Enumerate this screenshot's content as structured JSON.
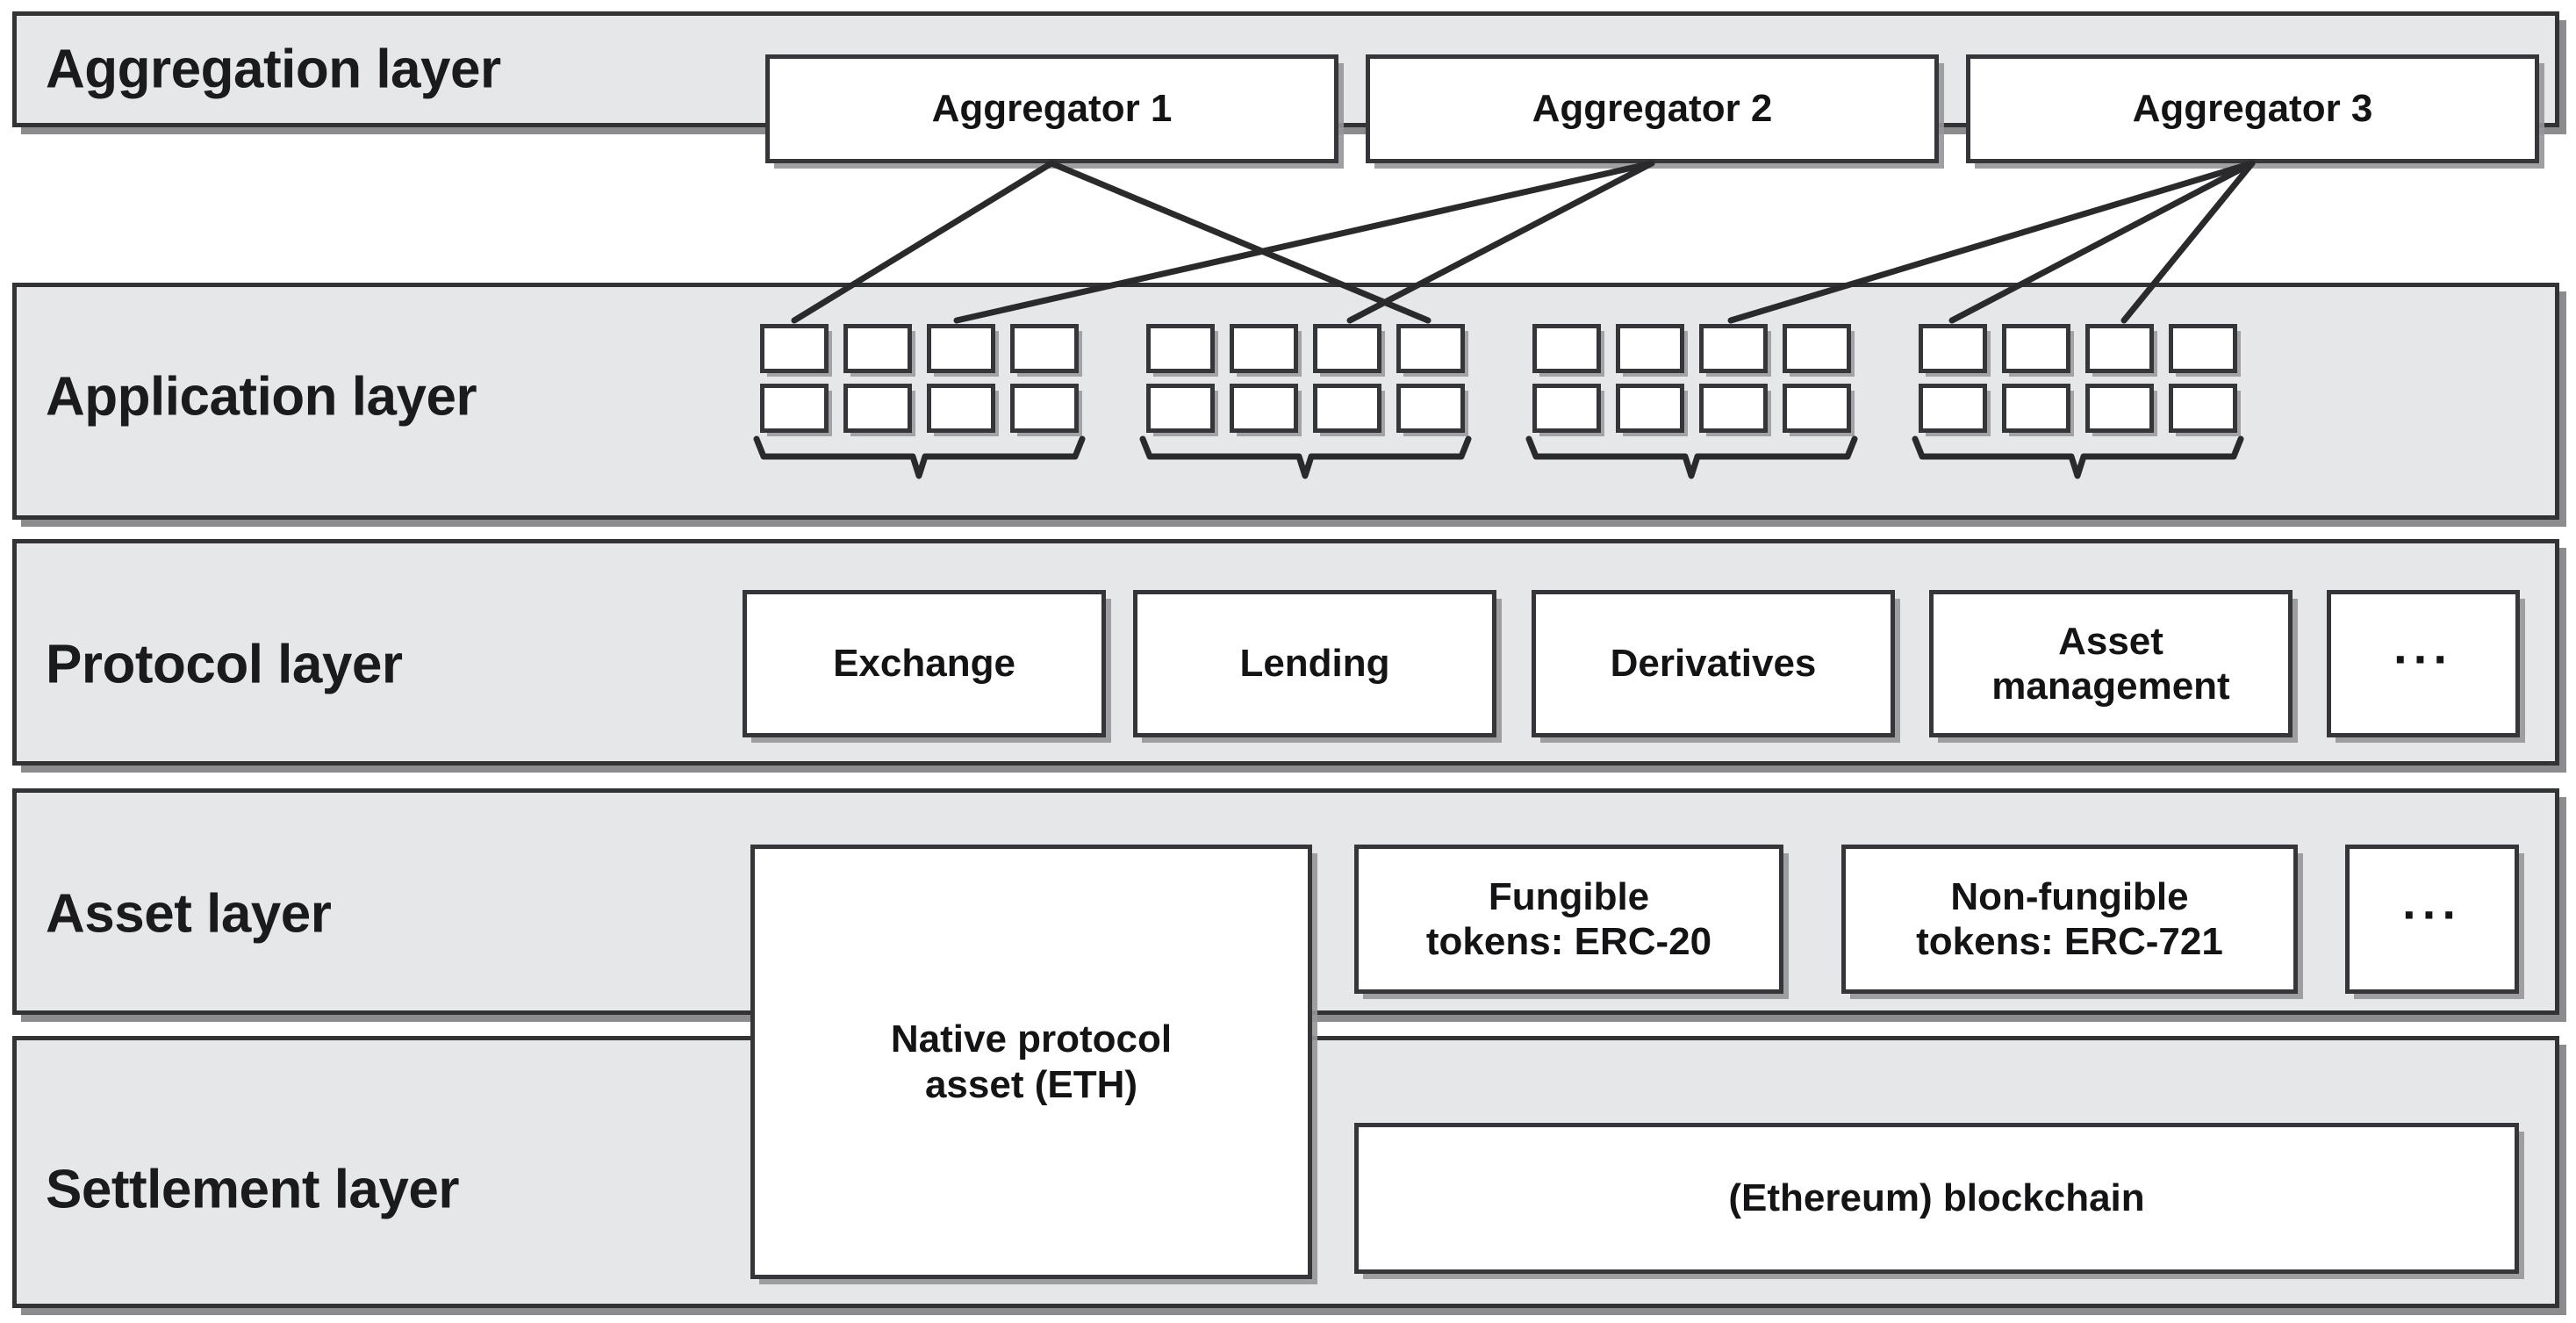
{
  "diagram": {
    "title": "DeFi layered architecture stack",
    "colors": {
      "band_fill": "#e6e7e8",
      "band_border": "#333335",
      "node_fill": "#ffffff",
      "node_border": "#35353a",
      "text": "#141416",
      "shadow": "#96969a"
    }
  },
  "layers": [
    {
      "id": "aggregation",
      "label": "Aggregation layer",
      "nodes": [
        {
          "label": "Aggregator 1"
        },
        {
          "label": "Aggregator 2"
        },
        {
          "label": "Aggregator 3"
        }
      ]
    },
    {
      "id": "application",
      "label": "Application layer",
      "groups": [
        {
          "id": "group-1",
          "columns": 4,
          "rows": 2,
          "count": 8
        },
        {
          "id": "group-2",
          "columns": 4,
          "rows": 2,
          "count": 8
        },
        {
          "id": "group-3",
          "columns": 4,
          "rows": 2,
          "count": 8
        },
        {
          "id": "group-4",
          "columns": 4,
          "rows": 2,
          "count": 8
        }
      ]
    },
    {
      "id": "protocol",
      "label": "Protocol layer",
      "nodes": [
        {
          "label": "Exchange"
        },
        {
          "label": "Lending"
        },
        {
          "label": "Derivatives"
        },
        {
          "label": "Asset\nmanagement"
        },
        {
          "label": "..."
        }
      ]
    },
    {
      "id": "asset",
      "label": "Asset layer",
      "nodes": [
        {
          "label": "Native protocol\nasset (ETH)"
        },
        {
          "label": "Fungible\ntokens: ERC-20"
        },
        {
          "label": "Non-fungible\ntokens: ERC-721"
        },
        {
          "label": "..."
        }
      ]
    },
    {
      "id": "settlement",
      "label": "Settlement layer",
      "nodes": [
        {
          "label": "(Ethereum) blockchain"
        }
      ]
    }
  ],
  "labels": {
    "aggregation": "Aggregation layer",
    "application": "Application layer",
    "protocol": "Protocol layer",
    "asset": "Asset layer",
    "settlement": "Settlement layer",
    "aggregator_1": "Aggregator 1",
    "aggregator_2": "Aggregator 2",
    "aggregator_3": "Aggregator 3",
    "exchange": "Exchange",
    "lending": "Lending",
    "derivatives": "Derivatives",
    "asset_management_l1": "Asset",
    "asset_management_l2": "management",
    "protocol_ellipsis": "···",
    "native_asset_l1": "Native protocol",
    "native_asset_l2": "asset (ETH)",
    "fungible_l1": "Fungible",
    "fungible_l2": "tokens: ERC-20",
    "nonfungible_l1": "Non-fungible",
    "nonfungible_l2": "tokens: ERC-721",
    "asset_ellipsis": "···",
    "blockchain": "(Ethereum) blockchain"
  }
}
